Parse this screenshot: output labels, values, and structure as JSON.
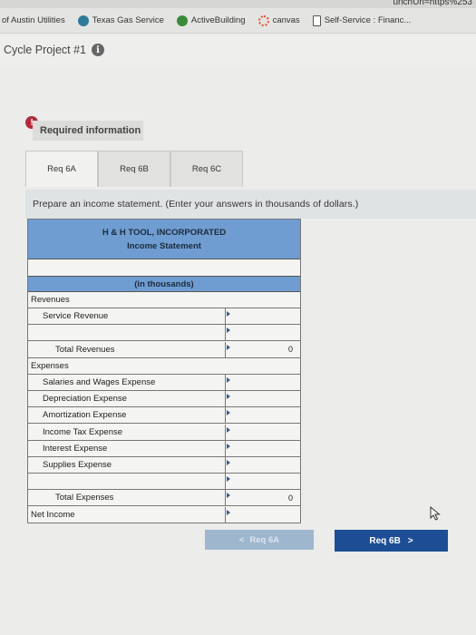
{
  "browser": {
    "url_fragment": "unchUrl=https%253",
    "bookmarks": [
      {
        "label": "of Austin Utilities",
        "icon": "none"
      },
      {
        "label": "Texas Gas Service",
        "icon": "flame-icon"
      },
      {
        "label": "ActiveBuilding",
        "icon": "globe-icon"
      },
      {
        "label": "canvas",
        "icon": "canvas-icon"
      },
      {
        "label": "Self-Service : Financ...",
        "icon": "document-icon"
      }
    ]
  },
  "assignment": {
    "title": "Cycle Project #1",
    "required_info": "Required information",
    "tabs": [
      "Req 6A",
      "Req 6B",
      "Req 6C"
    ],
    "active_tab": 0,
    "prompt": "Prepare an income statement. (Enter your answers in thousands of dollars.)"
  },
  "statement": {
    "company": "H & H TOOL, INCORPORATED",
    "title": "Income Statement",
    "unit": "(in thousands)",
    "rows": [
      {
        "label": "Revenues",
        "indent": 0,
        "value": "",
        "input": false
      },
      {
        "label": "Service Revenue",
        "indent": 1,
        "value": "",
        "input": true
      },
      {
        "label": "",
        "indent": 1,
        "value": "",
        "input": true
      },
      {
        "label": "Total Revenues",
        "indent": 2,
        "value": "0",
        "input": true
      },
      {
        "label": "Expenses",
        "indent": 0,
        "value": "",
        "input": false
      },
      {
        "label": "Salaries and Wages Expense",
        "indent": 1,
        "value": "",
        "input": true
      },
      {
        "label": "Depreciation Expense",
        "indent": 1,
        "value": "",
        "input": true
      },
      {
        "label": "Amortization Expense",
        "indent": 1,
        "value": "",
        "input": true
      },
      {
        "label": "Income Tax Expense",
        "indent": 1,
        "value": "",
        "input": true
      },
      {
        "label": "Interest Expense",
        "indent": 1,
        "value": "",
        "input": true
      },
      {
        "label": "Supplies Expense",
        "indent": 1,
        "value": "",
        "input": true
      },
      {
        "label": "",
        "indent": 1,
        "value": "",
        "input": true
      },
      {
        "label": "Total Expenses",
        "indent": 2,
        "value": "0",
        "input": true
      },
      {
        "label": "Net Income",
        "indent": 0,
        "value": "",
        "input": true
      }
    ]
  },
  "nav": {
    "prev_label": "Req 6A",
    "next_label": "Req 6B",
    "prev_glyph": "<",
    "next_glyph": ">"
  },
  "colors": {
    "header_blue": "#6f9dd2",
    "next_button": "#1d4e95",
    "prev_button": "#9fb6cf",
    "alert_red": "#b22a3a"
  }
}
